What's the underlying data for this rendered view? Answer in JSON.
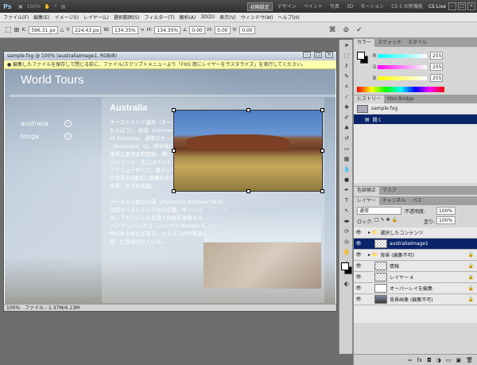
{
  "app": {
    "logo": "Ps",
    "zoom": "100%",
    "workspaces": [
      "初期設定",
      "デザイン",
      "ペイント",
      "写真",
      "3D",
      "モーション",
      "CS 5 の新機能"
    ],
    "cslive": "CS Live"
  },
  "menu": [
    "ファイル(F)",
    "編集(E)",
    "イメージ(I)",
    "レイヤー(L)",
    "選択範囲(S)",
    "フィルター(T)",
    "解析(A)",
    "3D(D)",
    "表示(V)",
    "ウィンドウ(W)",
    "ヘルプ(H)"
  ],
  "options": {
    "x_label": "X:",
    "x": "596.31 px",
    "y_label": "Y:",
    "y": "224.43 px",
    "w_label": "W:",
    "w": "134.35%",
    "h_label": "H:",
    "h": "134.35%",
    "angle": "0.00",
    "hskew_label": "H:",
    "hskew": "0.00",
    "vskew_label": "V:",
    "vskew": "0.00"
  },
  "document": {
    "title": "sample.fxg @ 100% (australiaImage1, RGB/8)",
    "warning": "● 編集したファイルを保存して閉じる前に、ファイル/スクリプトメニューより「FXG 用にレイヤーをラスタライズ」を実行してください。",
    "zoom": "100%",
    "file_info": "ファイル : 1.37M/4.13M"
  },
  "site": {
    "title": "World Tours",
    "nav": [
      "australia",
      "tonga"
    ],
    "heading": "Australia",
    "para1": "オーストラリア連邦（オーストラリアれんぽう）、英語: Commonwealth of Australia、通称はオーストラリア（Australia）は、南半球に位置する連邦立憲君主制国家。東にはニュージーランド、北にはインドネシア、パプアニューギニア、東ティモールがあり世界で6番目に面積の大きい国で、世界一大きな島国。",
    "para2": "パーヌルル国立公園（Purnululu National Park）は西オーストラリア州の北東、キンバリー地区にある。アボリジニの言葉で砂岩を意味するバングル・バングル/バンゲル・バンゲル(Bungle Bungle)と呼ばれる岩山があり、ユネスコの世界遺産（自然遺産）に登録されている。"
  },
  "color_panel": {
    "tabs": [
      "カラー",
      "スウォッチ",
      "スタイル"
    ],
    "r_label": "R",
    "g_label": "G",
    "b_label": "B",
    "r": "255",
    "g": "255",
    "b": "255"
  },
  "history_panel": {
    "tabs": [
      "ヒストリー",
      "Mini Bridge"
    ],
    "snapshot": "sample.fxg",
    "item": "開く"
  },
  "adjust_tabs": [
    "色調補正",
    "マスク"
  ],
  "layers_panel": {
    "tabs": [
      "レイヤー",
      "チャンネル",
      "パス"
    ],
    "blend_mode": "通常",
    "opacity_label": "不透明度:",
    "opacity": "100%",
    "lock_label": "ロック:",
    "fill_label": "塗り:",
    "fill": "100%",
    "layers": [
      {
        "name": "選択したコンテンツ",
        "type": "folder"
      },
      {
        "name": "australiaImage1",
        "type": "image",
        "selected": true
      },
      {
        "name": "背景 (編集不可)",
        "type": "folder",
        "lock": true
      },
      {
        "name": "情報",
        "type": "layer",
        "lock": true
      },
      {
        "name": "レイヤー 4",
        "type": "layer",
        "lock": true
      },
      {
        "name": "オーバーレイを編集",
        "type": "layer",
        "lock": true
      },
      {
        "name": "背景画像 (編集不可)",
        "type": "image",
        "lock": true
      }
    ]
  }
}
